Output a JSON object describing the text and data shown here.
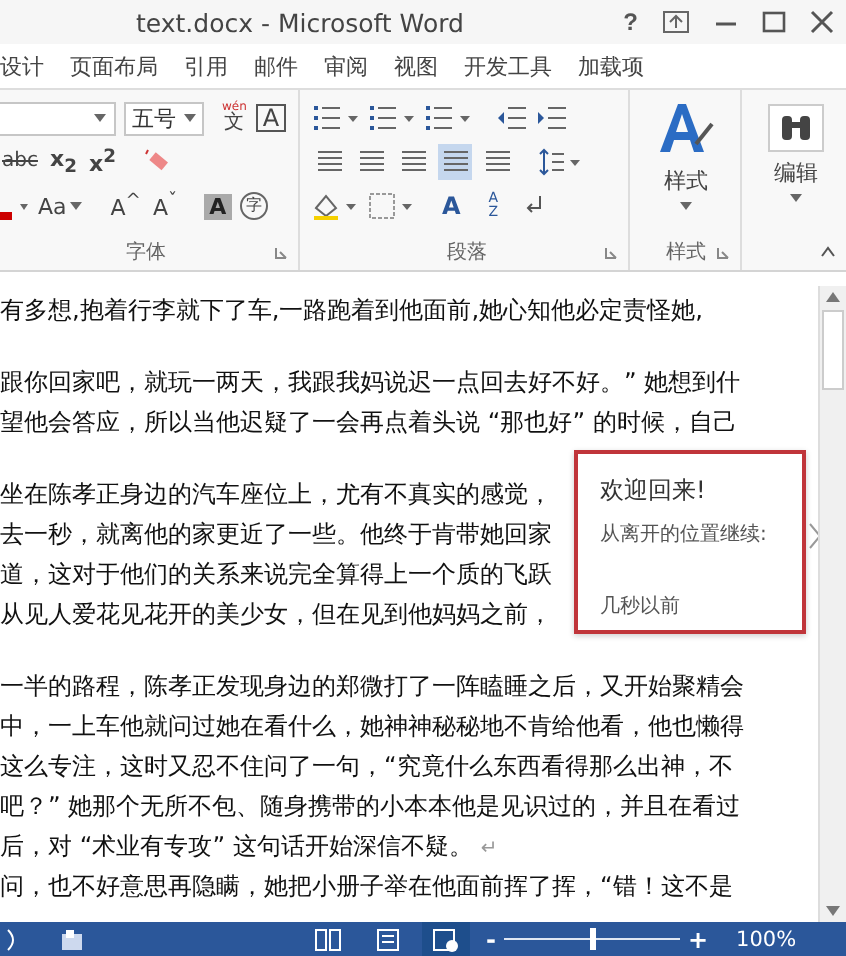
{
  "window": {
    "title": "text.docx - Microsoft Word",
    "help": "?"
  },
  "ribbon_tabs": [
    {
      "label": "设计",
      "selected": false
    },
    {
      "label": "页面布局",
      "selected": false
    },
    {
      "label": "引用",
      "selected": false
    },
    {
      "label": "邮件",
      "selected": false
    },
    {
      "label": "审阅",
      "selected": false
    },
    {
      "label": "视图",
      "selected": false
    },
    {
      "label": "开发工具",
      "selected": false
    },
    {
      "label": "加载项",
      "selected": false
    }
  ],
  "font_group": {
    "label": "字体",
    "font_size": "五号",
    "phonetic_top": "wén",
    "phonetic_char": "文",
    "char_border": "A",
    "strike": "abc",
    "subscript": "x$_{2}$",
    "superscript": "x$^{2}$",
    "change_case": "Aa",
    "grow": "A$^{^}$",
    "shrink": "A$^{ˇ}$",
    "shading": "A",
    "enclose": "字"
  },
  "paragraph_group": {
    "label": "段落",
    "align_buttons": [
      {
        "selected": false
      },
      {
        "selected": false
      },
      {
        "selected": false
      },
      {
        "selected": true
      },
      {
        "selected": false
      }
    ],
    "asian_layout": "A",
    "sort_top": "A",
    "sort_bottom": "Z"
  },
  "styles_group": {
    "label": "样式",
    "button": "样式"
  },
  "editing_group": {
    "button": "编辑"
  },
  "document": {
    "paragraphs": [
      {
        "lines": [
          {
            "text": "有多想,抱着行李就下了车,一路跑着到他面前,她心知他必定责怪她,"
          }
        ]
      },
      {
        "lines": [
          {
            "text": "跟你回家吧，就玩一两天，我跟我妈说迟一点回去好不好。” 她想到什"
          },
          {
            "text": "望他会答应，所以当他迟疑了一会再点着头说 “那也好” 的时候，自己"
          }
        ]
      },
      {
        "lines": [
          {
            "text": "坐在陈孝正身边的汽车座位上，尤有不真实的感觉，"
          },
          {
            "text": "去一秒，就离他的家更近了一些。他终于肯带她回家"
          },
          {
            "text": "道，这对于他们的关系来说完全算得上一个质的飞跃"
          },
          {
            "text": "从见人爱花见花开的美少女，但在见到他妈妈之前，"
          }
        ]
      },
      {
        "lines": [
          {
            "text": "一半的路程，陈孝正发现身边的郑微打了一阵瞌睡之后，又开始聚精会"
          },
          {
            "text": "中，一上车他就问过她在看什么，她神神秘秘地不肯给他看，他也懒得"
          },
          {
            "text": "这么专注，这时又忍不住问了一句，“究竟什么东西看得那么出神，不"
          },
          {
            "text": "吧？” 她那个无所不包、随身携带的小本本他是见识过的，并且在看过"
          },
          {
            "text": "后，对 “术业有专攻” 这句话开始深信不疑。",
            "end_mark": "↵"
          },
          {
            "text": "问，也不好意思再隐瞒，她把小册子举在他面前挥了挥，“错！这不是"
          }
        ]
      }
    ]
  },
  "resume_popup": {
    "title": "欢迎回来!",
    "message": "从离开的位置继续:",
    "time": "几秒以前"
  },
  "status_bar": {
    "zoom_minus": "-",
    "zoom_plus": "+",
    "zoom_slider": {
      "level": 0.5
    },
    "zoom": "100%"
  }
}
